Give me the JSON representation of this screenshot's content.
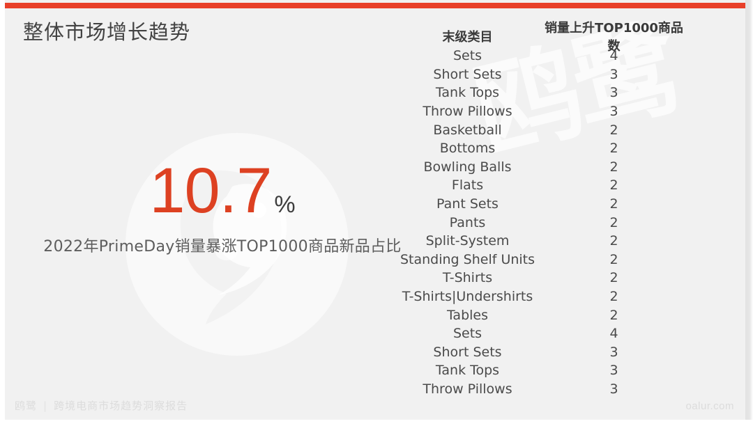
{
  "page": {
    "title": "整体市场增长趋势",
    "accent_color": "#e8402a",
    "background_color": "#f1f1f1"
  },
  "kpi": {
    "value": "10.7",
    "unit": "%",
    "caption": "2022年PrimeDay销量暴涨TOP1000商品新品占比",
    "value_color": "#dd4122",
    "unit_color": "#3d3d3d"
  },
  "watermark": {
    "text": "鸥鹭",
    "logo_name": "bird-logo-watermark"
  },
  "footer": {
    "brand": "鸥鹭",
    "separator": "|",
    "report": "跨境电商市场趋势洞察报告",
    "site": "oalur.com"
  },
  "chart_data": {
    "type": "table",
    "title": "整体市场增长趋势",
    "columns": [
      "末级类目",
      "销量上升TOP1000商品数"
    ],
    "categories": [
      "Sets",
      "Short Sets",
      "Tank Tops",
      "Throw Pillows",
      "Basketball",
      "Bottoms",
      "Bowling Balls",
      "Flats",
      "Pant Sets",
      "Pants",
      "Split-System",
      "Standing Shelf Units",
      "T-Shirts",
      "T-Shirts|Undershirts",
      "Tables",
      "Sets",
      "Short Sets",
      "Tank Tops",
      "Throw Pillows"
    ],
    "values": [
      4,
      3,
      3,
      3,
      2,
      2,
      2,
      2,
      2,
      2,
      2,
      2,
      2,
      2,
      2,
      4,
      3,
      3,
      3
    ],
    "rows": [
      {
        "category": "Sets",
        "count": "4"
      },
      {
        "category": "Short Sets",
        "count": "3"
      },
      {
        "category": "Tank Tops",
        "count": "3"
      },
      {
        "category": "Throw Pillows",
        "count": "3"
      },
      {
        "category": "Basketball",
        "count": "2"
      },
      {
        "category": "Bottoms",
        "count": "2"
      },
      {
        "category": "Bowling Balls",
        "count": "2"
      },
      {
        "category": "Flats",
        "count": "2"
      },
      {
        "category": "Pant Sets",
        "count": "2"
      },
      {
        "category": "Pants",
        "count": "2"
      },
      {
        "category": "Split-System",
        "count": "2"
      },
      {
        "category": "Standing Shelf Units",
        "count": "2"
      },
      {
        "category": "T-Shirts",
        "count": "2"
      },
      {
        "category": "T-Shirts|Undershirts",
        "count": "2"
      },
      {
        "category": "Tables",
        "count": "2"
      },
      {
        "category": "Sets",
        "count": "4"
      },
      {
        "category": "Short Sets",
        "count": "3"
      },
      {
        "category": "Tank Tops",
        "count": "3"
      },
      {
        "category": "Throw Pillows",
        "count": "3"
      }
    ],
    "xlabel": "",
    "ylabel": ""
  }
}
